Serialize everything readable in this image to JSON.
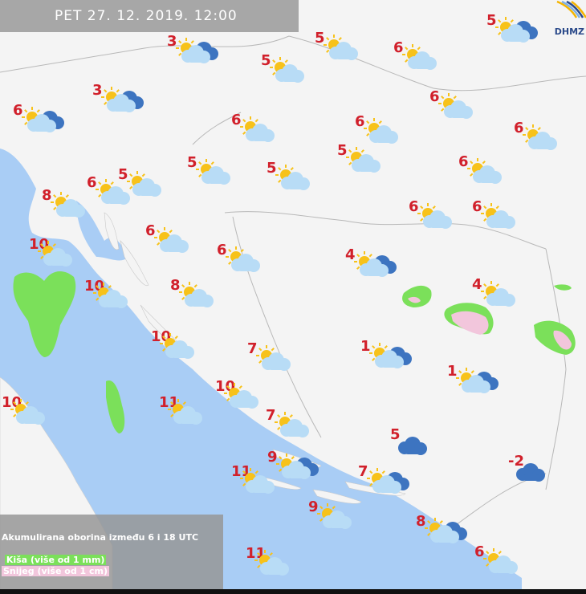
{
  "header": {
    "title": "PET  27. 12. 2019. 12:00"
  },
  "logo": {
    "text": "DHMZ"
  },
  "legend": {
    "title": "Akumulirana oborina između 6 i 18 UTC",
    "rain": "Kiša (više od 1 mm)",
    "snow": "Snijeg (više od 1 cm)",
    "rain_color": "#7be05a",
    "snow_color": "#f2c6dc"
  },
  "colors": {
    "sea": "#a9cdf5",
    "land": "#f4f4f4",
    "temp": "#d1202b",
    "sun": "#f7c21a",
    "cloud_light": "#b8dcf6",
    "cloud_dark": "#3d74c0"
  },
  "stations": [
    {
      "temp": "3",
      "icon": "sun-dark-cloud"
    },
    {
      "temp": "5",
      "icon": "sun-cloud"
    },
    {
      "temp": "5",
      "icon": "sun-dark-cloud"
    },
    {
      "temp": "6",
      "icon": "sun-cloud"
    },
    {
      "temp": "5",
      "icon": "sun-cloud"
    },
    {
      "temp": "3",
      "icon": "sun-dark-cloud"
    },
    {
      "temp": "6",
      "icon": "sun-cloud"
    },
    {
      "temp": "6",
      "icon": "sun-dark-cloud"
    },
    {
      "temp": "6",
      "icon": "sun-cloud"
    },
    {
      "temp": "6",
      "icon": "sun-cloud"
    },
    {
      "temp": "6",
      "icon": "sun-cloud"
    },
    {
      "temp": "5",
      "icon": "sun-cloud"
    },
    {
      "temp": "5",
      "icon": "sun-cloud"
    },
    {
      "temp": "5",
      "icon": "sun-cloud"
    },
    {
      "temp": "6",
      "icon": "sun-cloud"
    },
    {
      "temp": "6",
      "icon": "sun-cloud"
    },
    {
      "temp": "5",
      "icon": "sun-cloud"
    },
    {
      "temp": "8",
      "icon": "sun-cloud"
    },
    {
      "temp": "6",
      "icon": "sun-cloud"
    },
    {
      "temp": "6",
      "icon": "sun-cloud"
    },
    {
      "temp": "6",
      "icon": "sun-cloud"
    },
    {
      "temp": "10",
      "icon": "sun-cloud"
    },
    {
      "temp": "6",
      "icon": "sun-cloud"
    },
    {
      "temp": "4",
      "icon": "sun-dark-cloud"
    },
    {
      "temp": "10",
      "icon": "sun-cloud"
    },
    {
      "temp": "8",
      "icon": "sun-cloud"
    },
    {
      "temp": "4",
      "icon": "sun-cloud"
    },
    {
      "temp": "10",
      "icon": "sun-cloud"
    },
    {
      "temp": "7",
      "icon": "sun-cloud"
    },
    {
      "temp": "1",
      "icon": "sun-dark-cloud"
    },
    {
      "temp": "1",
      "icon": "sun-dark-cloud"
    },
    {
      "temp": "10",
      "icon": "sun-cloud"
    },
    {
      "temp": "11",
      "icon": "sun-cloud"
    },
    {
      "temp": "10",
      "icon": "sun-cloud"
    },
    {
      "temp": "7",
      "icon": "sun-cloud"
    },
    {
      "temp": "5",
      "icon": "dark-cloud"
    },
    {
      "temp": "9",
      "icon": "sun-dark-cloud"
    },
    {
      "temp": "-2",
      "icon": "dark-cloud"
    },
    {
      "temp": "11",
      "icon": "sun-cloud"
    },
    {
      "temp": "7",
      "icon": "sun-dark-cloud"
    },
    {
      "temp": "9",
      "icon": "sun-cloud"
    },
    {
      "temp": "8",
      "icon": "sun-dark-cloud"
    },
    {
      "temp": "6",
      "icon": "sun-cloud"
    },
    {
      "temp": "11",
      "icon": "sun-cloud"
    }
  ]
}
